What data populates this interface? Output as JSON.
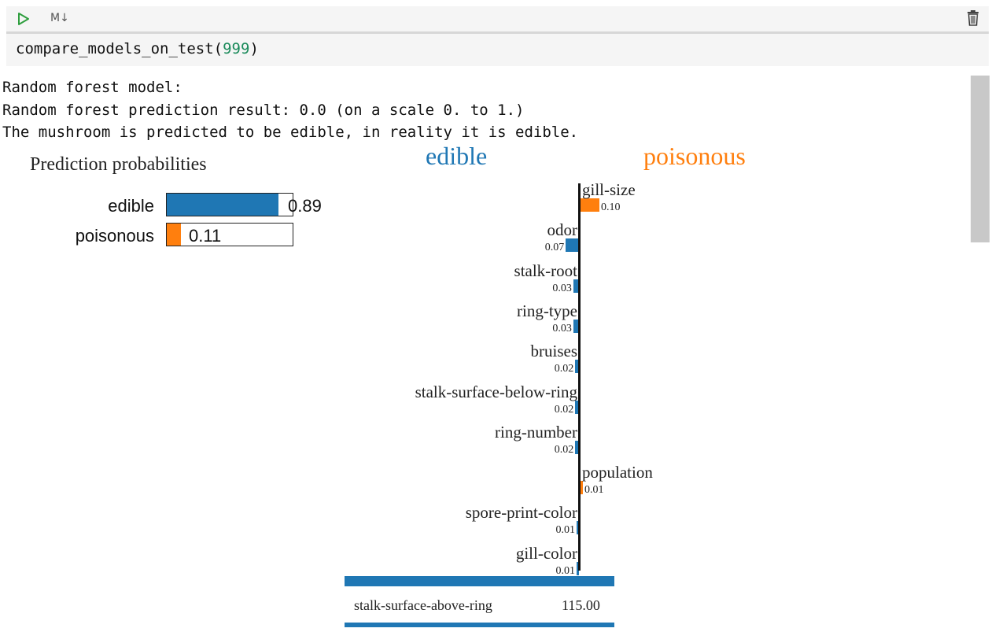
{
  "toolbar": {
    "cell_type_label": "M↓",
    "run_icon": "play-icon",
    "delete_icon": "trash-icon"
  },
  "cell": {
    "code_fn": "compare_models_on_test(",
    "code_arg": "999",
    "code_close": ")"
  },
  "output": {
    "lines": [
      "Random forest model:",
      "Random forest prediction result: 0.0 (on a scale 0. to 1.)",
      "The mushroom is predicted to be edible, in reality it is edible."
    ]
  },
  "prediction": {
    "title": "Prediction probabilities",
    "items": [
      {
        "label": "edible",
        "value": 0.89,
        "value_text": "0.89",
        "color": "#1f77b4"
      },
      {
        "label": "poisonous",
        "value": 0.11,
        "value_text": "0.11",
        "color": "#ff7f0e"
      }
    ]
  },
  "chart_data": {
    "type": "bar",
    "class_labels": {
      "left": "edible",
      "right": "poisonous"
    },
    "colors": {
      "edible": "#1f77b4",
      "poisonous": "#ff7f0e"
    },
    "features": [
      {
        "name": "gill-size",
        "weight": 0.1,
        "weight_text": "0.10",
        "class": "poisonous"
      },
      {
        "name": "odor",
        "weight": 0.07,
        "weight_text": "0.07",
        "class": "edible"
      },
      {
        "name": "stalk-root",
        "weight": 0.03,
        "weight_text": "0.03",
        "class": "edible"
      },
      {
        "name": "ring-type",
        "weight": 0.03,
        "weight_text": "0.03",
        "class": "edible"
      },
      {
        "name": "bruises",
        "weight": 0.02,
        "weight_text": "0.02",
        "class": "edible"
      },
      {
        "name": "stalk-surface-below-ring",
        "weight": 0.02,
        "weight_text": "0.02",
        "class": "edible"
      },
      {
        "name": "ring-number",
        "weight": 0.02,
        "weight_text": "0.02",
        "class": "edible"
      },
      {
        "name": "population",
        "weight": 0.01,
        "weight_text": "0.01",
        "class": "poisonous"
      },
      {
        "name": "spore-print-color",
        "weight": 0.01,
        "weight_text": "0.01",
        "class": "edible"
      },
      {
        "name": "gill-color",
        "weight": 0.01,
        "weight_text": "0.01",
        "class": "edible"
      }
    ]
  },
  "feature_table": {
    "rows": [
      {
        "feature": "stalk-surface-above-ring",
        "value": "115.00"
      }
    ]
  }
}
